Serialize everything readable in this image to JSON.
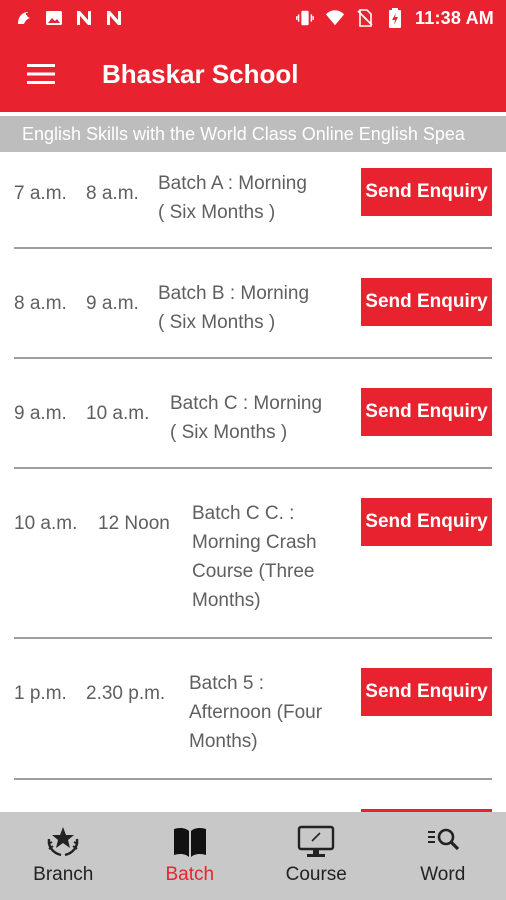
{
  "status_bar": {
    "time": "11:38 AM",
    "left_icons": [
      "notification-app-icon",
      "image-icon",
      "n-icon",
      "n-icon"
    ],
    "right_icons": [
      "vibrate-icon",
      "wifi-icon",
      "no-sim-icon",
      "battery-icon"
    ]
  },
  "app_bar": {
    "title": "Bhaskar School",
    "menu_icon": "menu-icon"
  },
  "marquee": {
    "text": "English Skills with the World Class Online English Spea"
  },
  "batches": [
    {
      "start": "7 a.m.",
      "end": "8 a.m.",
      "desc_line1": "Batch A : Morning",
      "desc_line2": "( Six Months )",
      "desc_line3": "",
      "desc_line4": "",
      "button": "Send Enquiry"
    },
    {
      "start": "8 a.m.",
      "end": "9 a.m.",
      "desc_line1": "Batch B :  Morning",
      "desc_line2": "( Six Months )",
      "desc_line3": "",
      "desc_line4": "",
      "button": "Send Enquiry"
    },
    {
      "start": "9 a.m.",
      "end": "10 a.m.",
      "desc_line1": "Batch C :  Morning",
      "desc_line2": "( Six Months )",
      "desc_line3": "",
      "desc_line4": "",
      "button": "Send Enquiry"
    },
    {
      "start": "10 a.m.",
      "end": "12 Noon",
      "desc_line1": "Batch C C. :",
      "desc_line2": "Morning  Crash",
      "desc_line3": "Course (Three",
      "desc_line4": "Months)",
      "button": "Send Enquiry"
    },
    {
      "start": "1 p.m.",
      "end": "2.30 p.m.",
      "desc_line1": "Batch 5 :",
      "desc_line2": "Afternoon (Four",
      "desc_line3": "Months)",
      "desc_line4": "",
      "button": "Send Enquiry"
    }
  ],
  "bottom_nav": {
    "items": [
      {
        "label": "Branch",
        "icon": "branch-star-icon",
        "active": false
      },
      {
        "label": "Batch",
        "icon": "book-icon",
        "active": true
      },
      {
        "label": "Course",
        "icon": "monitor-icon",
        "active": false
      },
      {
        "label": "Word",
        "icon": "word-search-icon",
        "active": false
      }
    ]
  },
  "colors": {
    "primary": "#e8232f",
    "marquee_bg": "#bdbdbd",
    "nav_bg": "#c8c8c8",
    "text_gray": "#5f5f5f"
  }
}
